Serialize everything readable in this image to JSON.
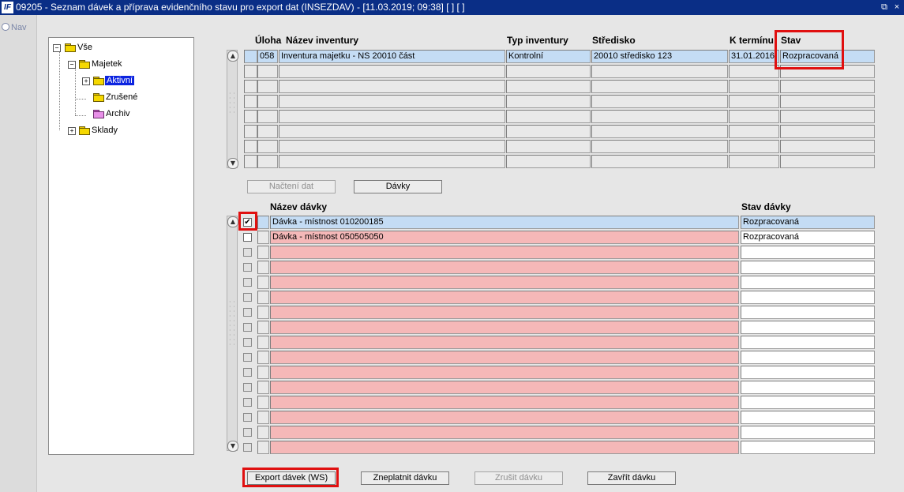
{
  "window": {
    "title": "09205 - Seznam dávek a příprava evidenčního stavu pro export dat (INSEZDAV) - [11.03.2019; 09:38]  [ ]  [ ]",
    "logo": "IF",
    "restore_glyph": "⧉",
    "close_glyph": "×"
  },
  "nav": {
    "label": "Nav"
  },
  "tree": {
    "items": [
      "Vše",
      "Majetek",
      "Aktivní",
      "Zrušené",
      "Archiv",
      "Sklady"
    ]
  },
  "inventory": {
    "headers": {
      "uloha": "Úloha",
      "nazev": "Název inventury",
      "typ": "Typ inventury",
      "stredisko": "Středisko",
      "termin": "K termínu",
      "stav": "Stav"
    },
    "row": {
      "uloha": "058",
      "nazev": "Inventura majetku - NS 20010 část",
      "typ": "Kontrolní",
      "stredisko": "20010 středisko 123",
      "termin": "31.01.2016",
      "stav": "Rozpracovaná"
    }
  },
  "mid_buttons": {
    "nacteni": "Načtení dat",
    "davky": "Dávky"
  },
  "batches": {
    "headers": {
      "nazev": "Název dávky",
      "stav": "Stav dávky"
    },
    "rows": [
      {
        "nazev": "Dávka - místnost 010200185",
        "stav": "Rozpracovaná",
        "checked": true
      },
      {
        "nazev": "Dávka - místnost 050505050",
        "stav": "Rozpracovaná",
        "checked": false
      }
    ]
  },
  "bottom_buttons": {
    "export": "Export dávek (WS)",
    "zneplatnit": "Zneplatnit dávku",
    "zrusit": "Zrušit dávku",
    "zavrit": "Zavřít dávku"
  }
}
